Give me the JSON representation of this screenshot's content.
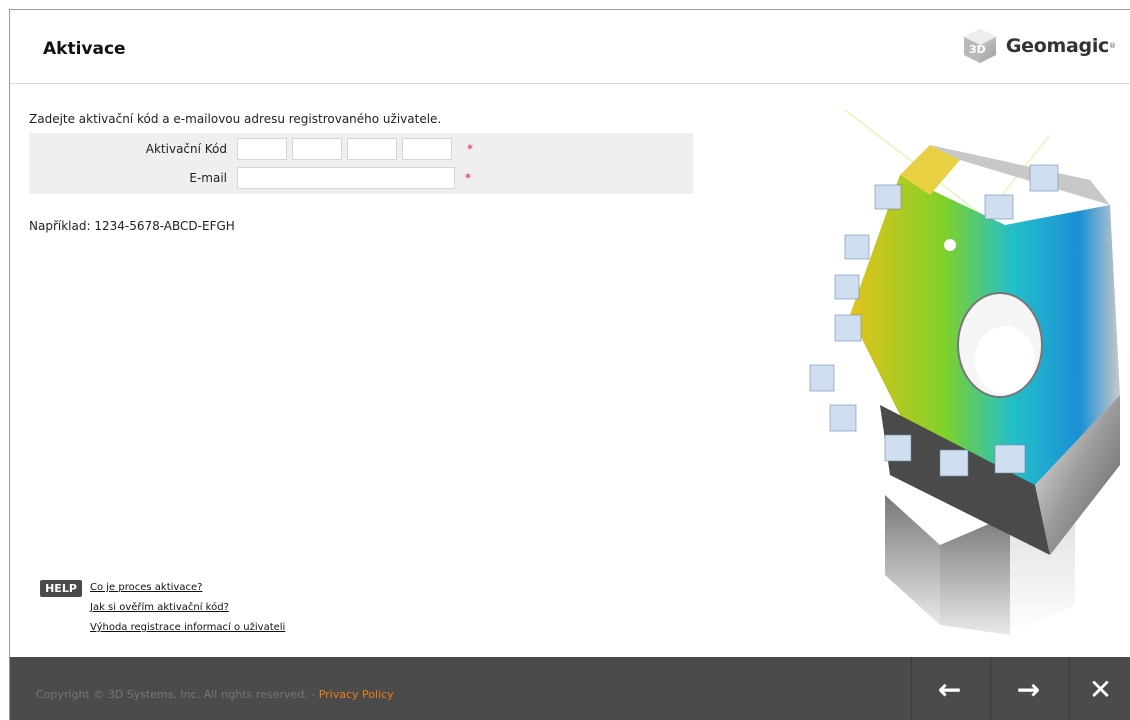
{
  "header": {
    "title": "Aktivace",
    "logo_text": "Geomagic",
    "logo_tm": "®"
  },
  "main": {
    "intro": "Zadejte aktivační kód a e-mailovou adresu registrovaného uživatele.",
    "form": {
      "activation_code_label": "Aktivační Kód",
      "activation_code_values": [
        "",
        "",
        "",
        ""
      ],
      "email_label": "E-mail",
      "email_value": "",
      "required_marker": "*"
    },
    "example": "Například: 1234-5678-ABCD-EFGH"
  },
  "help": {
    "badge": "HELP",
    "links": [
      "Co je proces aktivace?",
      "Jak si ověřím aktivační kód?",
      "Výhoda registrace informací o uživateli"
    ]
  },
  "footer": {
    "copyright": "Copyright © 3D Systems, Inc. All rights reserved. -",
    "privacy_link": "Privacy Policy",
    "back_icon": "←",
    "next_icon": "→",
    "close_icon": "✕"
  },
  "colors": {
    "footer_bg": "#4b4b4b",
    "privacy_link": "#e97c18",
    "required": "#dd2233",
    "form_bg": "#efefef"
  },
  "icons": [
    "geomagic-logo-icon",
    "back-arrow-icon",
    "next-arrow-icon",
    "close-icon"
  ]
}
